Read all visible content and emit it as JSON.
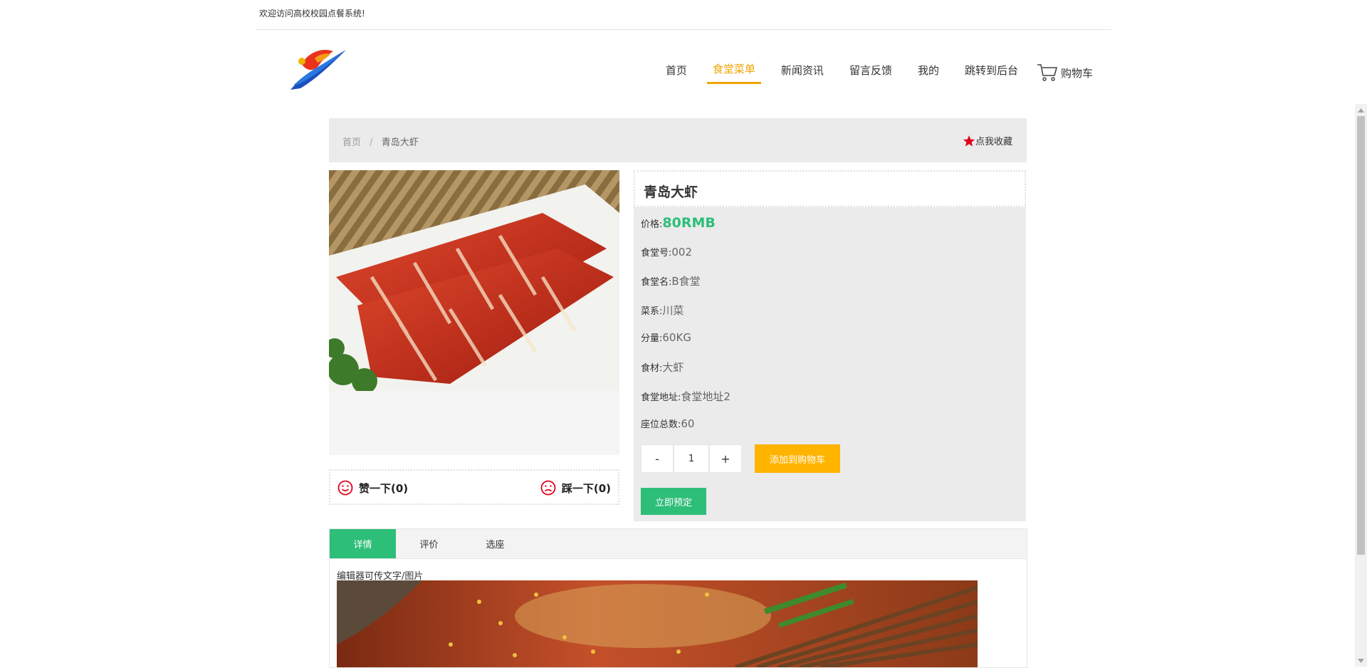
{
  "topbar": {
    "welcome": "欢迎访问高校校园点餐系统!"
  },
  "nav": {
    "items": [
      {
        "label": "首页"
      },
      {
        "label": "食堂菜单",
        "active": true
      },
      {
        "label": "新闻资讯"
      },
      {
        "label": "留言反馈"
      },
      {
        "label": "我的"
      },
      {
        "label": "跳转到后台"
      }
    ],
    "cart_label": "购物车",
    "active_color": "#f0a500"
  },
  "breadcrumb": {
    "home": "首页",
    "separator": "/",
    "current": "青岛大虾"
  },
  "favorite": {
    "label": "点我收藏",
    "icon": "star-icon"
  },
  "votes": {
    "like": "赞一下(0)",
    "dislike": "踩一下(0)"
  },
  "product": {
    "title": "青岛大虾",
    "fields": [
      {
        "label": "价格:",
        "value": "80RMB",
        "highlight": true
      },
      {
        "label": "食堂号:",
        "value": "002"
      },
      {
        "label": "食堂名:",
        "value": "B食堂"
      },
      {
        "label": "菜系:",
        "value": "川菜"
      },
      {
        "label": "分量:",
        "value": "60KG"
      },
      {
        "label": "食材:",
        "value": "大虾"
      },
      {
        "label": "食堂地址:",
        "value": "食堂地址2"
      },
      {
        "label": "座位总数:",
        "value": "60"
      }
    ],
    "quantity": {
      "minus": "-",
      "value": "1",
      "plus": "+"
    },
    "add_to_cart": "添加到购物车",
    "book_now": "立即预定"
  },
  "tabs": [
    {
      "label": "详情",
      "active": true
    },
    {
      "label": "评价"
    },
    {
      "label": "选座"
    }
  ],
  "detail": {
    "editor_text": "编辑器可传文字/图片"
  },
  "colors": {
    "green": "#2dbe78",
    "orange": "#ffb400",
    "panel": "#ebebeb"
  }
}
